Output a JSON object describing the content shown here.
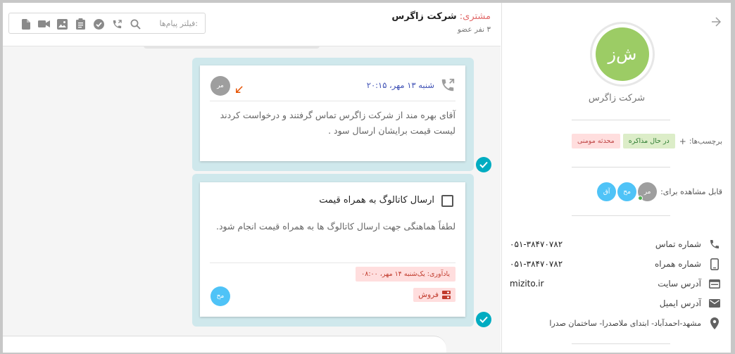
{
  "header": {
    "title_prefix": "مشتری:",
    "title_name": "شرکت زاگرس",
    "subtitle": "۳ نفر عضو",
    "filter_placeholder": "فیلتر پیام‌ها:",
    "tool_icons": [
      "file-icon",
      "video-icon",
      "image-icon",
      "clipboard-icon",
      "check-circle-icon",
      "phone-call-icon",
      "search-icon"
    ]
  },
  "profile": {
    "avatar_text": "ش‌ز",
    "avatar_color": "#9ccc65",
    "company_name": "شرکت زاگرس",
    "tags_label": "برچسب‌ها:",
    "tags_add": "+",
    "tags": [
      {
        "label": "در حال مذاکره",
        "color": "green"
      },
      {
        "label": "محدثه مومنی",
        "color": "red"
      }
    ],
    "visible_label": "قابل مشاهده برای:",
    "visible_members": [
      {
        "initials": "مر",
        "color": "#9e9e9e",
        "online": true
      },
      {
        "initials": "مح",
        "color": "#4fc3f7",
        "online": false
      },
      {
        "initials": "آق",
        "color": "#4fc3f7",
        "online": false
      }
    ],
    "info": [
      {
        "icon": "phone-icon",
        "label": "شماره تماس",
        "value": "۰۵۱-۳۸۴۷۰۷۸۲"
      },
      {
        "icon": "mobile-icon",
        "label": "شماره همراه",
        "value": "۰۵۱-۳۸۴۷۰۷۸۲"
      },
      {
        "icon": "web-icon",
        "label": "آدرس سایت",
        "value": "mizito.ir"
      },
      {
        "icon": "email-icon",
        "label": "آدرس ایمیل",
        "value": ""
      }
    ],
    "address": {
      "icon": "location-icon",
      "text": "مشهد-احمدآباد- ابتدای ملاصدرا- ساختمان صدرا"
    }
  },
  "messages": {
    "call": {
      "date": "شنبه ۱۳ مهر، ۲۰:۱۵",
      "author_initials": "مر",
      "text": "آقای بهره مند از شرکت زاگرس تماس گرفتند و درخواست کردند لیست قیمت برایشان ارسال سود ."
    },
    "task": {
      "title": "ارسال کاتالوگ به همراه قیمت",
      "text": "لطفاً هماهنگی جهت ارسال کاتالوگ ها به همراه قیمت انجام شود.",
      "reminder": "یادآوری: یک‌شنبه ۱۴ مهر، ۰۸:۰۰",
      "category": "فروش",
      "author_initials": "مح"
    }
  },
  "colors": {
    "bubble": "#cfe8ec",
    "check": "#00acc1",
    "tag_red_bg": "#ffdede",
    "tag_green_bg": "#dcedc8",
    "date_blue": "#3f51b5"
  }
}
